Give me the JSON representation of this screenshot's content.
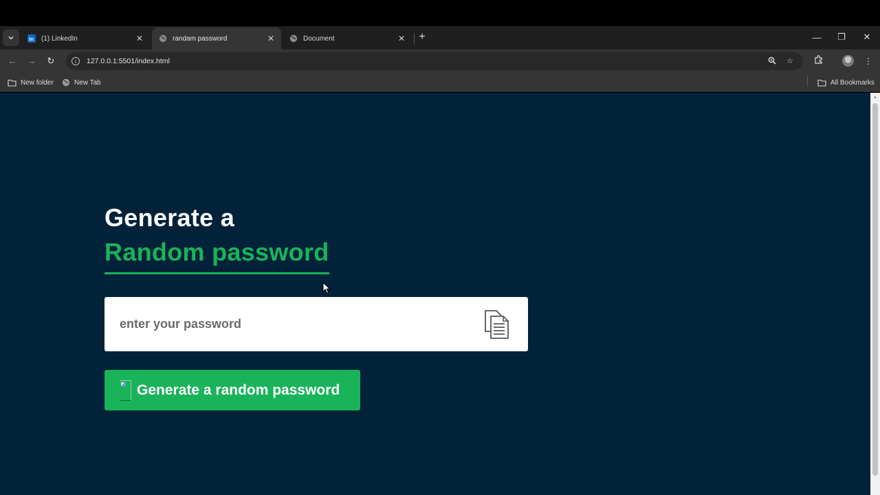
{
  "browser": {
    "tabs": [
      {
        "title": "(1) LinkedIn",
        "active": false,
        "favicon": "linkedin-icon"
      },
      {
        "title": "randam password",
        "active": true,
        "favicon": "globe-icon"
      },
      {
        "title": "Document",
        "active": false,
        "favicon": "globe-icon"
      }
    ],
    "address": "127.0.0.1:5501/index.html",
    "bookmarks": [
      {
        "label": "New folder",
        "icon": "folder-icon"
      },
      {
        "label": "New Tab",
        "icon": "globe-icon"
      }
    ],
    "all_bookmarks": "All Bookmarks"
  },
  "page": {
    "heading_line1": "Generate a",
    "heading_line2": "Random password",
    "password_placeholder": "enter your password",
    "password_value": "",
    "generate_button": "Generate a random password",
    "colors": {
      "background": "#02223a",
      "accent": "#19b359",
      "input_bg": "#ffffff"
    }
  }
}
